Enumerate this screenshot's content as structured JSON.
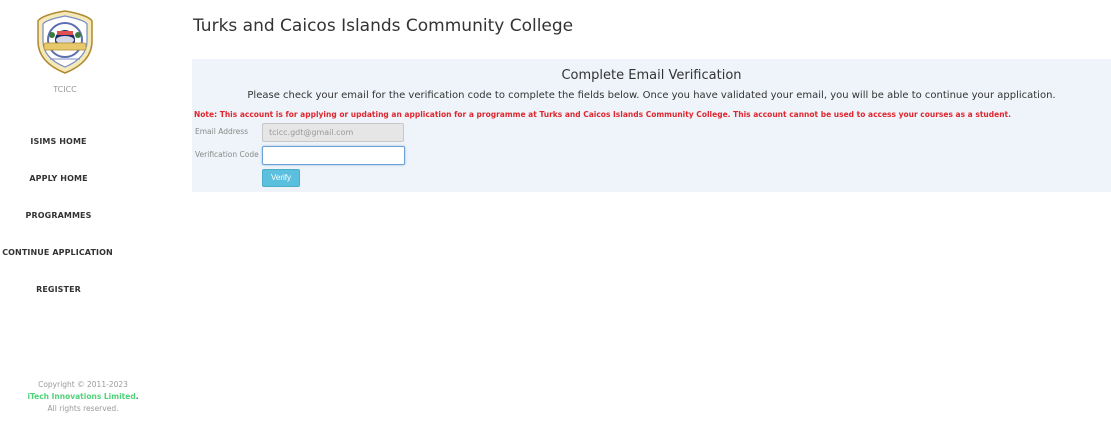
{
  "sidebar": {
    "logo_alt": "TCICC crest",
    "org_abbr": "TCICC",
    "nav": [
      {
        "label": "ISIMS HOME"
      },
      {
        "label": "APPLY HOME"
      },
      {
        "label": "PROGRAMMES"
      },
      {
        "label": "CONTINUE APPLICATION"
      },
      {
        "label": "REGISTER"
      }
    ],
    "footer": {
      "copyright": "Copyright © 2011-2023",
      "brand": "iTech Innovations Limited",
      "brand_suffix": ".",
      "rights": "All rights reserved."
    }
  },
  "main": {
    "page_title": "Turks and Caicos Islands Community College",
    "panel": {
      "title": "Complete Email Verification",
      "subtitle": "Please check your email for the verification code to complete the fields below. Once you have validated your email, you will be able to continue your application.",
      "note": "Note: This account is for applying or updating an application for a programme at Turks and Caicos Islands Community College. This account cannot be used to access your courses as a student.",
      "email_label": "Email Address",
      "email_value": "tcicc.gdt@gmail.com",
      "code_label": "Verification Code",
      "code_value": "",
      "verify_label": "Verify"
    }
  },
  "colors": {
    "panel_bg": "#eef4f9",
    "note_red": "#e0262f",
    "verify_btn": "#5bc0de",
    "brand_green": "#4fd37a"
  }
}
